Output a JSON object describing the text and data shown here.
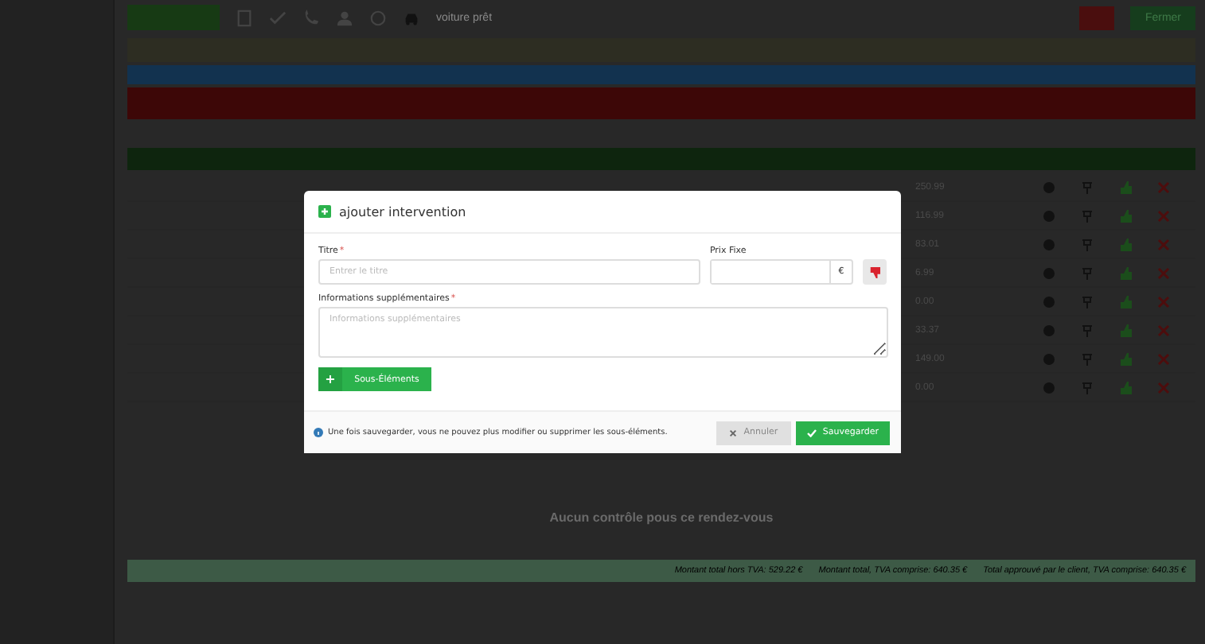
{
  "toolbar": {
    "status_label": "voiture prêt",
    "close_button": "Fermer"
  },
  "rows": [
    {
      "amount": "250.99"
    },
    {
      "amount": "116.99"
    },
    {
      "amount": "83.01"
    },
    {
      "amount": "6.99"
    },
    {
      "amount": "0.00"
    },
    {
      "amount": "33.37"
    },
    {
      "amount": "149.00"
    },
    {
      "amount": "0.00"
    }
  ],
  "empty_message": "Aucun contrôle pous ce rendez-vous",
  "totals": [
    "Montant total hors TVA: 529.22 €",
    "Montant total, TVA comprise: 640.35 €",
    "Total approuvé par le client, TVA comprise: 640.35 €"
  ],
  "modal": {
    "title": "ajouter intervention",
    "title_field": {
      "label": "Titre",
      "required_mark": "*",
      "placeholder": "Entrer le titre"
    },
    "price_field": {
      "label": "Prix Fixe",
      "suffix": "€"
    },
    "info_field": {
      "label": "Informations supplémentaires",
      "required_mark": "*",
      "placeholder": "Informations supplémentaires"
    },
    "sub_button": {
      "icon": "+",
      "label": "Sous-Éléments"
    },
    "note": "Une fois sauvegarder, vous ne pouvez plus modifier ou supprimer les sous-éléments.",
    "cancel": "Annuler",
    "save": "Sauvegarder"
  }
}
